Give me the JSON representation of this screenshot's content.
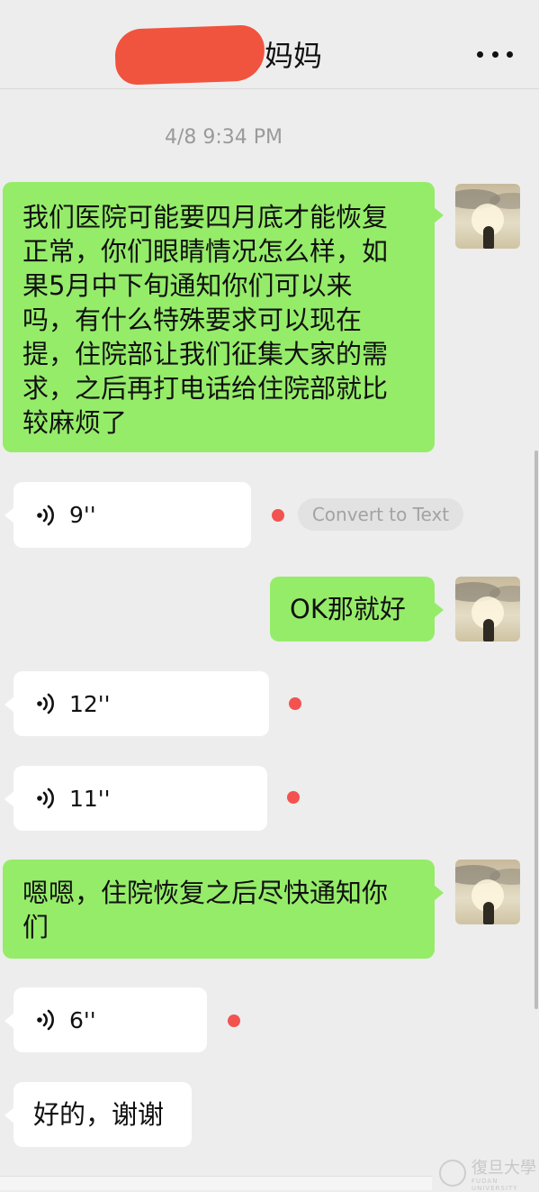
{
  "header": {
    "contact_name": "妈妈"
  },
  "timestamp": "4/8 9:34 PM",
  "messages": [
    {
      "direction": "out",
      "type": "text",
      "lines": [
        "我们医院可能要四月底才能恢复",
        "正常，你们眼睛情况怎么样，如",
        "果5月中下旬通知你们可以来",
        "吗，有什么特殊要求可以现在",
        "提，住院部让我们征集大家的需",
        "求，之后再打电话给住院部就比",
        "较麻烦了"
      ]
    },
    {
      "direction": "in",
      "type": "voice",
      "duration": "9''",
      "unread": true,
      "convert_label": "Convert to Text"
    },
    {
      "direction": "out",
      "type": "text",
      "lines": [
        "OK那就好"
      ]
    },
    {
      "direction": "in",
      "type": "voice",
      "duration": "12''",
      "unread": true
    },
    {
      "direction": "in",
      "type": "voice",
      "duration": "11''",
      "unread": true
    },
    {
      "direction": "out",
      "type": "text",
      "lines": [
        "嗯嗯，住院恢复之后尽快通知你",
        "们"
      ]
    },
    {
      "direction": "in",
      "type": "voice",
      "duration": "6''",
      "unread": true
    },
    {
      "direction": "in",
      "type": "text",
      "lines": [
        "好的，谢谢"
      ]
    }
  ],
  "watermark": {
    "text": "復旦大學",
    "sub": "FUDAN UNIVERSITY"
  },
  "colors": {
    "background": "#ededed",
    "outgoing_bubble": "#95ec69",
    "incoming_bubble": "#ffffff",
    "unread_dot": "#f25350",
    "redaction": "#f0533e"
  },
  "icons": [
    "more-icon",
    "voice-wave-icon",
    "avatar"
  ]
}
